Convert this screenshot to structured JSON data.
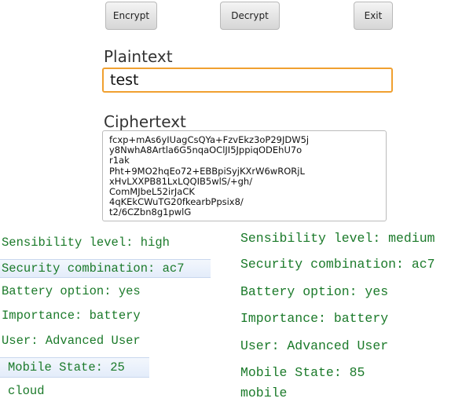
{
  "app": {
    "buttons": {
      "encrypt": "Encrypt",
      "decrypt": "Decrypt",
      "exit": "Exit"
    },
    "plaintext_label": "Plaintext",
    "plaintext_value": "test",
    "ciphertext_label": "Ciphertext",
    "ciphertext_value": "fcxp+mAs6yIUagCsQYa+FzvEkz3oP29JDW5j\ny8NwhA8Artla6G5nqaOClJI5JppiqODEhU7o\nr1ak\nPht+9MO2hqEo72+EBBpiSyjKXrW6wRORjL\nxHvLXXPB81LxLQQIB5wlS/+gh/\nComMJbeL52irJaCK\n4qKEkCWuTG20fkearbPpsix8/\nt2/6CZbn8g1pwlG"
  },
  "log_left": {
    "sensibility": "Sensibility level: high",
    "security": "Security combination: ac7",
    "battery": "Battery option: yes",
    "importance": "Importance: battery",
    "user": "User: Advanced User",
    "mobile_state": "Mobile State: 25",
    "location": "cloud"
  },
  "log_right": {
    "sensibility": "Sensibility level: medium",
    "security": "Security combination: ac7",
    "battery": "Battery option: yes",
    "importance": "Importance: battery",
    "user": "User: Advanced User",
    "mobile_state": "Mobile State: 85",
    "location": "mobile"
  },
  "colors": {
    "log_text": "#1b7a2a",
    "focus_border": "#f0a030",
    "row_highlight": "#e3ecfa"
  }
}
